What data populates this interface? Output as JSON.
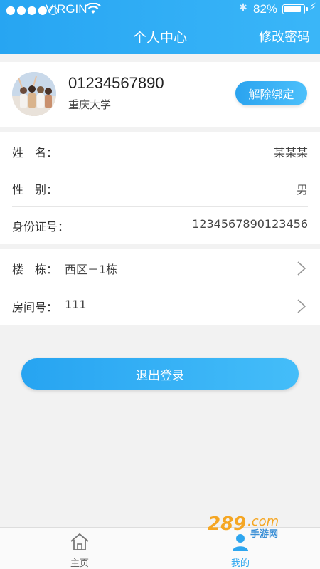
{
  "status_bar": {
    "signal": "●●●●○",
    "carrier": "VIRGIN",
    "battery": "82%"
  },
  "header": {
    "title": "个人中心",
    "change_password": "修改密码"
  },
  "profile": {
    "phone": "01234567890",
    "school": "重庆大学",
    "unbind_label": "解除绑定"
  },
  "info": {
    "rows": [
      {
        "label": "姓　名：",
        "value": "某某某"
      },
      {
        "label": "性　别：",
        "value": "男"
      },
      {
        "label": "身份证号：",
        "value": "1234567890123456"
      }
    ]
  },
  "address": {
    "rows": [
      {
        "label": "楼　栋：",
        "value": "西区－1栋"
      },
      {
        "label": "房间号：",
        "value": "111"
      }
    ]
  },
  "logout_label": "退出登录",
  "tabs": [
    {
      "label": "主页",
      "icon": "home-icon"
    },
    {
      "label": "我的",
      "icon": "user-icon"
    }
  ],
  "watermark": {
    "text": "289.com 手游网"
  },
  "colors": {
    "primary": "#2ea6ef",
    "background": "#f2f2f2"
  }
}
